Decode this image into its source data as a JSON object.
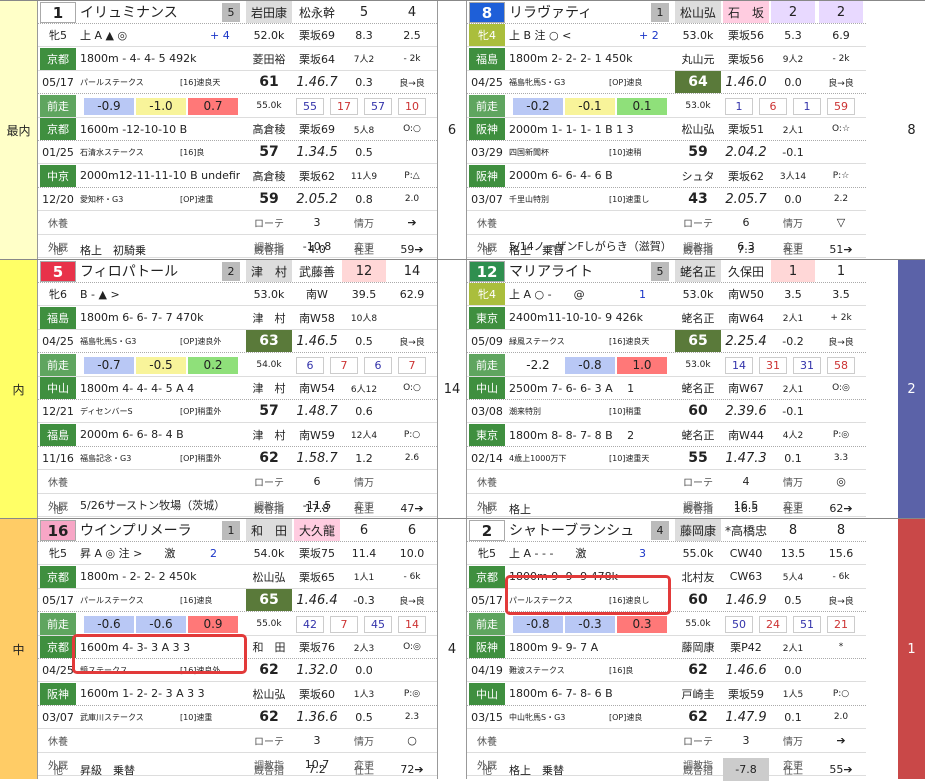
{
  "groups": [
    {
      "label": "最内",
      "bg": "#ffffc8",
      "center_num": "6",
      "right_num": "8",
      "right_bg": "#ffffff",
      "horses": [
        {
          "num": "1",
          "num_bg": "#ffffff",
          "num_fg": "#222",
          "name": "イリュミナンス",
          "pop": "5",
          "jockey": "岩田康",
          "trainer": "松永幹",
          "odds1": "5",
          "odds2": "4",
          "sex_age": "牝5",
          "marks": "上 A ▲ ◎",
          "marks2": "+ 4",
          "marks3": "2",
          "weight": "52.0k",
          "t1": "栗坂69",
          "t2": "8.3",
          "t3": "2.5",
          "r1": {
            "track": "京都",
            "dist": "1800m",
            "pos": "- 4- 4- 5",
            "wt": "492k",
            "date": "05/17",
            "race": "パールステークス",
            "cls": "[16]速良天",
            "jk": "菱田裕",
            "time": "1.46.7",
            "tr": "栗坂64",
            "diff": "0.3",
            "place": "7人2",
            "pace": "- 2k",
            "cond": "良→良",
            "cv": "61"
          },
          "bars": [
            "-0.9",
            "-1.0",
            "0.7"
          ],
          "bar_w": "55.0k",
          "bar_n": [
            "55",
            "17",
            "57",
            "10"
          ],
          "r2": {
            "track": "京都",
            "dist": "1600m",
            "pos": "-12-10-10 B",
            "date": "01/25",
            "race": "石清水ステークス",
            "cls": "[16]良",
            "jk": "高倉稜",
            "time": "1.34.5",
            "tr": "栗坂69",
            "diff": "0.5",
            "place": "5人8",
            "pace": "O:○",
            "cv": "57"
          },
          "r3": {
            "track": "中京",
            "dist": "2000m12-11-11-10 B",
            "date": "12/20",
            "race": "愛知杯・G3",
            "cls": "[OP]速重",
            "jk": "高倉稜",
            "time": "2.05.2",
            "tr": "栗坂62",
            "diff": "0.8",
            "place": "11人9",
            "pace": "P:△",
            "cv": "59",
            "p2": "2.0"
          },
          "rest": {
            "l1": "休養",
            "l2": "外厩",
            "l3": "他",
            "note": "",
            "other": "格上　初騎乗",
            "rote": "ローテ",
            "rote_v": "3",
            "jouho": "情万",
            "chokyo": "調教指",
            "chokyo_v": "-10.8",
            "henko": "変更",
            "kyori": "厩舎指",
            "kyori_v": "4.0",
            "shiage": "仕上",
            "arrow": "➔",
            "last": "59➔"
          }
        },
        {
          "num": "8",
          "num_bg": "#1e5fd8",
          "num_fg": "#fff",
          "name": "リラヴァティ",
          "pop": "1",
          "jockey": "松山弘",
          "trainer": "石　坂",
          "odds1": "2",
          "odds2": "2",
          "sex_age": "牝4",
          "marks": "上 B 注 ○ <",
          "marks2": "+ 2",
          "marks3": "",
          "weight": "53.0k",
          "t1": "栗坂56",
          "t2": "5.3",
          "t3": "6.9",
          "r1": {
            "track": "福島",
            "dist": "1800m",
            "pos": "2- 2- 2- 1",
            "wt": "450k",
            "date": "04/25",
            "race": "福島牝馬S・G3",
            "cls": "[OP]速良",
            "jk": "丸山元",
            "time": "1.46.0",
            "tr": "栗坂56",
            "diff": "0.0",
            "place": "9人2",
            "pace": "- 2k",
            "cond": "良→良",
            "cv": "64"
          },
          "bars": [
            "-0.2",
            "-0.1",
            "0.1"
          ],
          "bar_w": "53.0k",
          "bar_n": [
            "1",
            "6",
            "1",
            "59"
          ],
          "r2": {
            "track": "阪神",
            "dist": "2000m",
            "pos": "1- 1- 1- 1 B 1 3",
            "date": "03/29",
            "race": "四国新聞杯",
            "cls": "[10]速稍",
            "jk": "松山弘",
            "time": "2.04.2",
            "tr": "栗坂51",
            "diff": "-0.1",
            "place": "2人1",
            "pace": "O:☆",
            "cv": "59"
          },
          "r3": {
            "track": "阪神",
            "dist": "2000m",
            "pos": "6- 6- 4- 6 B",
            "date": "03/07",
            "race": "千里山特別",
            "cls": "[10]速重し",
            "jk": "シュタ",
            "time": "2.05.7",
            "tr": "栗坂62",
            "diff": "0.0",
            "place": "3人14",
            "pace": "P:☆",
            "cv": "43",
            "p2": "2.2"
          },
          "rest": {
            "l1": "休養",
            "l2": "外厩",
            "l3": "他",
            "note": "5/14ノーザンFしがらき（滋賀）",
            "other": "格上　乗替",
            "rote": "ローテ",
            "rote_v": "6",
            "jouho": "情万",
            "chokyo": "調教指",
            "chokyo_v": "6.3",
            "henko": "変更",
            "kyori": "厩舎指",
            "kyori_v": "7.3",
            "shiage": "仕上",
            "arrow": "▽",
            "last": "51➔"
          }
        }
      ]
    },
    {
      "label": "内",
      "bg": "#ffff66",
      "center_num": "14",
      "right_num": "2",
      "right_bg": "#5b62a8",
      "horses": [
        {
          "num": "5",
          "num_bg": "#e8324a",
          "num_fg": "#fff",
          "name": "フィロパトール",
          "pop": "2",
          "jockey": "津　村",
          "trainer": "武藤善",
          "odds1": "12",
          "odds2": "14",
          "sex_age": "牝6",
          "marks": "B - ▲ >",
          "marks2": "",
          "marks3": "",
          "weight": "53.0k",
          "t1": "南W",
          "t2": "39.5",
          "t3": "62.9",
          "r1": {
            "track": "福島",
            "dist": "1800m",
            "pos": "6- 6- 7- 7",
            "wt": "470k",
            "date": "04/25",
            "race": "福島牝馬S・G3",
            "cls": "[OP]速良外",
            "jk": "津　村",
            "time": "1.46.5",
            "tr": "南W58",
            "diff": "0.5",
            "place": "10人8",
            "pace": "",
            "cond": "良→良",
            "cv": "63"
          },
          "bars": [
            "-0.7",
            "-0.5",
            "0.2"
          ],
          "bar_w": "54.0k",
          "bar_n": [
            "6",
            "7",
            "6",
            "7"
          ],
          "r2": {
            "track": "中山",
            "dist": "1800m",
            "pos": "4- 4- 4- 5 A 4",
            "date": "12/21",
            "race": "ディセンバーS",
            "cls": "[OP]稍重外",
            "jk": "津　村",
            "time": "1.48.7",
            "tr": "南W54",
            "diff": "0.6",
            "place": "6人12",
            "pace": "O:○",
            "cv": "57"
          },
          "r3": {
            "track": "福島",
            "dist": "2000m",
            "pos": "6- 6- 8- 4 B",
            "date": "11/16",
            "race": "福島記念・G3",
            "cls": "[OP]稍重外",
            "jk": "津　村",
            "time": "1.58.7",
            "tr": "南W59",
            "diff": "1.2",
            "place": "12人4",
            "pace": "P:○",
            "cv": "62",
            "p2": "2.6"
          },
          "rest": {
            "l1": "休養",
            "l2": "外厩",
            "l3": "他",
            "note": "5/26サーストン牧場（茨城）",
            "other": "",
            "rote": "ローテ",
            "rote_v": "6",
            "jouho": "情万",
            "chokyo": "調教指",
            "chokyo_v": "-11.5",
            "henko": "変更",
            "kyori": "厩舎指",
            "kyori_v": "17.8",
            "shiage": "仕上",
            "arrow": "",
            "last": "47➔"
          }
        },
        {
          "num": "12",
          "num_bg": "#2f8f4f",
          "num_fg": "#fff",
          "name": "マリアライト",
          "pop": "5",
          "jockey": "蛯名正",
          "trainer": "久保田",
          "odds1": "1",
          "odds2": "1",
          "sex_age": "牝4",
          "marks": "上 A ○ -　　@",
          "marks2": "1",
          "marks3": "",
          "weight": "53.0k",
          "t1": "南W50",
          "t2": "3.5",
          "t3": "3.5",
          "r1": {
            "track": "東京",
            "dist": "2400m11-10-10- 9",
            "pos": "",
            "wt": "426k",
            "date": "05/09",
            "race": "緑風ステークス",
            "cls": "[16]速良天",
            "jk": "蛯名正",
            "time": "2.25.4",
            "tr": "南W64",
            "diff": "-0.2",
            "place": "2人1",
            "pace": "+ 2k",
            "cond": "良→良",
            "cv": "65"
          },
          "bars": [
            "-2.2",
            "-0.8",
            "1.0"
          ],
          "bar_w": "53.0k",
          "bar_n": [
            "14",
            "31",
            "31",
            "58"
          ],
          "r2": {
            "track": "中山",
            "dist": "2500m",
            "pos": "7- 6- 6- 3 A　 1",
            "date": "03/08",
            "race": "潮来特別",
            "cls": "[10]稍重",
            "jk": "蛯名正",
            "time": "2.39.6",
            "tr": "南W67",
            "diff": "-0.1",
            "place": "2人1",
            "pace": "O:◎",
            "cv": "60"
          },
          "r3": {
            "track": "東京",
            "dist": "1800m",
            "pos": "8- 8- 7- 8 B　 2",
            "date": "02/14",
            "race": "4歳上1000万下",
            "cls": "[10]速重天",
            "jk": "蛯名正",
            "time": "1.47.3",
            "tr": "南W44",
            "diff": "0.1",
            "place": "4人2",
            "pace": "P:◎",
            "cv": "55",
            "p2": "3.3"
          },
          "rest": {
            "l1": "休養",
            "l2": "外厩",
            "l3": "他",
            "note": "",
            "other": "格上",
            "rote": "ローテ",
            "rote_v": "4",
            "jouho": "情万",
            "chokyo": "調教指",
            "chokyo_v": "16.5",
            "henko": "変更",
            "kyori": "厩舎指",
            "kyori_v": "16.5",
            "shiage": "仕上",
            "arrow": "◎",
            "last": "62➔"
          }
        }
      ]
    },
    {
      "label": "中",
      "bg": "#ffcc66",
      "center_num": "4",
      "right_num": "1",
      "right_bg": "#c94848",
      "horses": [
        {
          "num": "16",
          "num_bg": "#f7a6c6",
          "num_fg": "#222",
          "name": "ウインプリメーラ",
          "pop": "1",
          "jockey": "和　田",
          "trainer": "大久龍",
          "odds1": "6",
          "odds2": "6",
          "sex_age": "牝5",
          "marks": "昇 A ◎ 注 >　　激",
          "marks2": "2",
          "marks3": "",
          "weight": "54.0k",
          "t1": "栗坂75",
          "t2": "11.4",
          "t3": "10.0",
          "r1": {
            "track": "京都",
            "dist": "1800m",
            "pos": "- 2- 2- 2",
            "wt": "450k",
            "date": "05/17",
            "race": "パールステークス",
            "cls": "[16]速良",
            "jk": "松山弘",
            "time": "1.46.4",
            "tr": "栗坂65",
            "diff": "-0.3",
            "place": "1人1",
            "pace": "- 6k",
            "cond": "良→良",
            "cv": "65"
          },
          "bars": [
            "-0.6",
            "-0.6",
            "0.9"
          ],
          "bar_w": "55.0k",
          "bar_n": [
            "42",
            "7",
            "45",
            "14"
          ],
          "r2": {
            "track": "京都",
            "dist": "1600m",
            "pos": "4- 3- 3 A 3 3",
            "date": "04/25",
            "race": "鏡ステークス",
            "cls": "[16]速良外",
            "jk": "和　田",
            "time": "1.32.0",
            "tr": "栗坂76",
            "diff": "0.0",
            "place": "2人3",
            "pace": "O:◎",
            "cv": "62"
          },
          "r3": {
            "track": "阪神",
            "dist": "1600m",
            "pos": "1- 2- 2- 3 A 3 3",
            "date": "03/07",
            "race": "武庫川ステークス",
            "cls": "[10]速重",
            "jk": "松山弘",
            "time": "1.36.6",
            "tr": "栗坂60",
            "diff": "0.5",
            "place": "1人3",
            "pace": "P:◎",
            "cv": "62",
            "p2": "2.3"
          },
          "rest": {
            "l1": "休養",
            "l2": "外厩",
            "l3": "他",
            "note": "",
            "other": "昇級　乗替",
            "rote": "ローテ",
            "rote_v": "3",
            "jouho": "情万",
            "chokyo": "調教指",
            "chokyo_v": "10.7",
            "henko": "変更",
            "kyori": "厩舎指",
            "kyori_v": "7.2",
            "shiage": "仕上",
            "arrow": "○",
            "last": "72➔"
          }
        },
        {
          "num": "2",
          "num_bg": "#ffffff",
          "num_fg": "#222",
          "name": "シャトーブランシュ",
          "pop": "4",
          "jockey": "藤岡康",
          "trainer": "*高橋忠",
          "odds1": "8",
          "odds2": "8",
          "sex_age": "牝5",
          "marks": "上 A - - -　　激",
          "marks2": "3",
          "marks3": "",
          "weight": "55.0k",
          "t1": "CW40",
          "t2": "13.5",
          "t3": "15.6",
          "r1": {
            "track": "京都",
            "dist": "1800m",
            "pos": "9- 9- 9",
            "wt": "478k",
            "date": "05/17",
            "race": "パールステークス",
            "cls": "[16]速良し",
            "jk": "北村友",
            "time": "1.46.9",
            "tr": "CW63",
            "diff": "0.5",
            "place": "5人4",
            "pace": "- 6k",
            "cond": "良→良",
            "cv": "60"
          },
          "bars": [
            "-0.8",
            "-0.3",
            "0.3"
          ],
          "bar_w": "55.0k",
          "bar_n": [
            "50",
            "24",
            "51",
            "21"
          ],
          "r2": {
            "track": "阪神",
            "dist": "1800m",
            "pos": "9- 9- 7 A",
            "date": "04/19",
            "race": "難波ステークス",
            "cls": "[16]良",
            "jk": "藤岡康",
            "time": "1.46.6",
            "tr": "栗P42",
            "diff": "0.0",
            "place": "2人1",
            "pace": "*",
            "cv": "62"
          },
          "r3": {
            "track": "中山",
            "dist": "1800m",
            "pos": "6- 7- 8- 6 B",
            "date": "03/15",
            "race": "中山牝馬S・G3",
            "cls": "[OP]速良",
            "jk": "戸崎圭",
            "time": "1.47.9",
            "tr": "栗坂59",
            "diff": "0.1",
            "place": "1人5",
            "pace": "P:○",
            "cv": "62",
            "p2": "2.0"
          },
          "rest": {
            "l1": "休養",
            "l2": "外厩",
            "l3": "他",
            "note": "",
            "other": "格上　乗替",
            "rote": "ローテ",
            "rote_v": "3",
            "jouho": "情万",
            "chokyo": "調教指",
            "chokyo_v": "-2.9",
            "henko": "変更",
            "kyori": "厩舎指",
            "kyori_v": "-7.8",
            "shiage": "仕上",
            "arrow": "➔",
            "last": "55➔"
          }
        }
      ]
    }
  ],
  "colors": {
    "track_green": "#3f8f3f",
    "bar_blue": "#b9c8f5",
    "bar_yellow": "#f8f49a",
    "bar_green": "#8fe07a",
    "bar_red": "#ff7878",
    "highlight_circle": "#e23a3a"
  }
}
